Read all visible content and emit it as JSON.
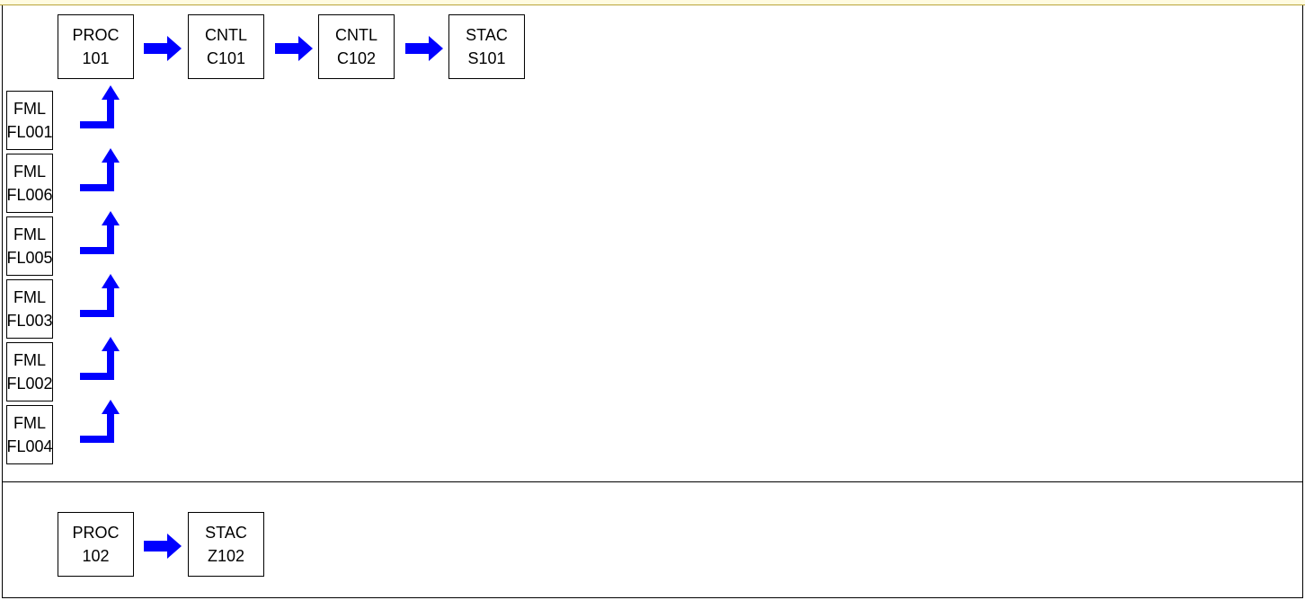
{
  "colors": {
    "arrow": "#0000ff",
    "border": "#000000",
    "background": "#ffffff",
    "topbar": "#fffbe0"
  },
  "icons": {
    "flow_arrow": "right-arrow-icon",
    "feed_arrow": "elbow-up-arrow-icon"
  },
  "flow1": {
    "nodes": [
      {
        "type": "PROC",
        "id": "101"
      },
      {
        "type": "CNTL",
        "id": "C101"
      },
      {
        "type": "CNTL",
        "id": "C102"
      },
      {
        "type": "STAC",
        "id": "S101"
      }
    ],
    "inputs": [
      {
        "type": "FML",
        "id": "FL001"
      },
      {
        "type": "FML",
        "id": "FL006"
      },
      {
        "type": "FML",
        "id": "FL005"
      },
      {
        "type": "FML",
        "id": "FL003"
      },
      {
        "type": "FML",
        "id": "FL002"
      },
      {
        "type": "FML",
        "id": "FL004"
      }
    ]
  },
  "flow2": {
    "nodes": [
      {
        "type": "PROC",
        "id": "102"
      },
      {
        "type": "STAC",
        "id": "Z102"
      }
    ]
  }
}
